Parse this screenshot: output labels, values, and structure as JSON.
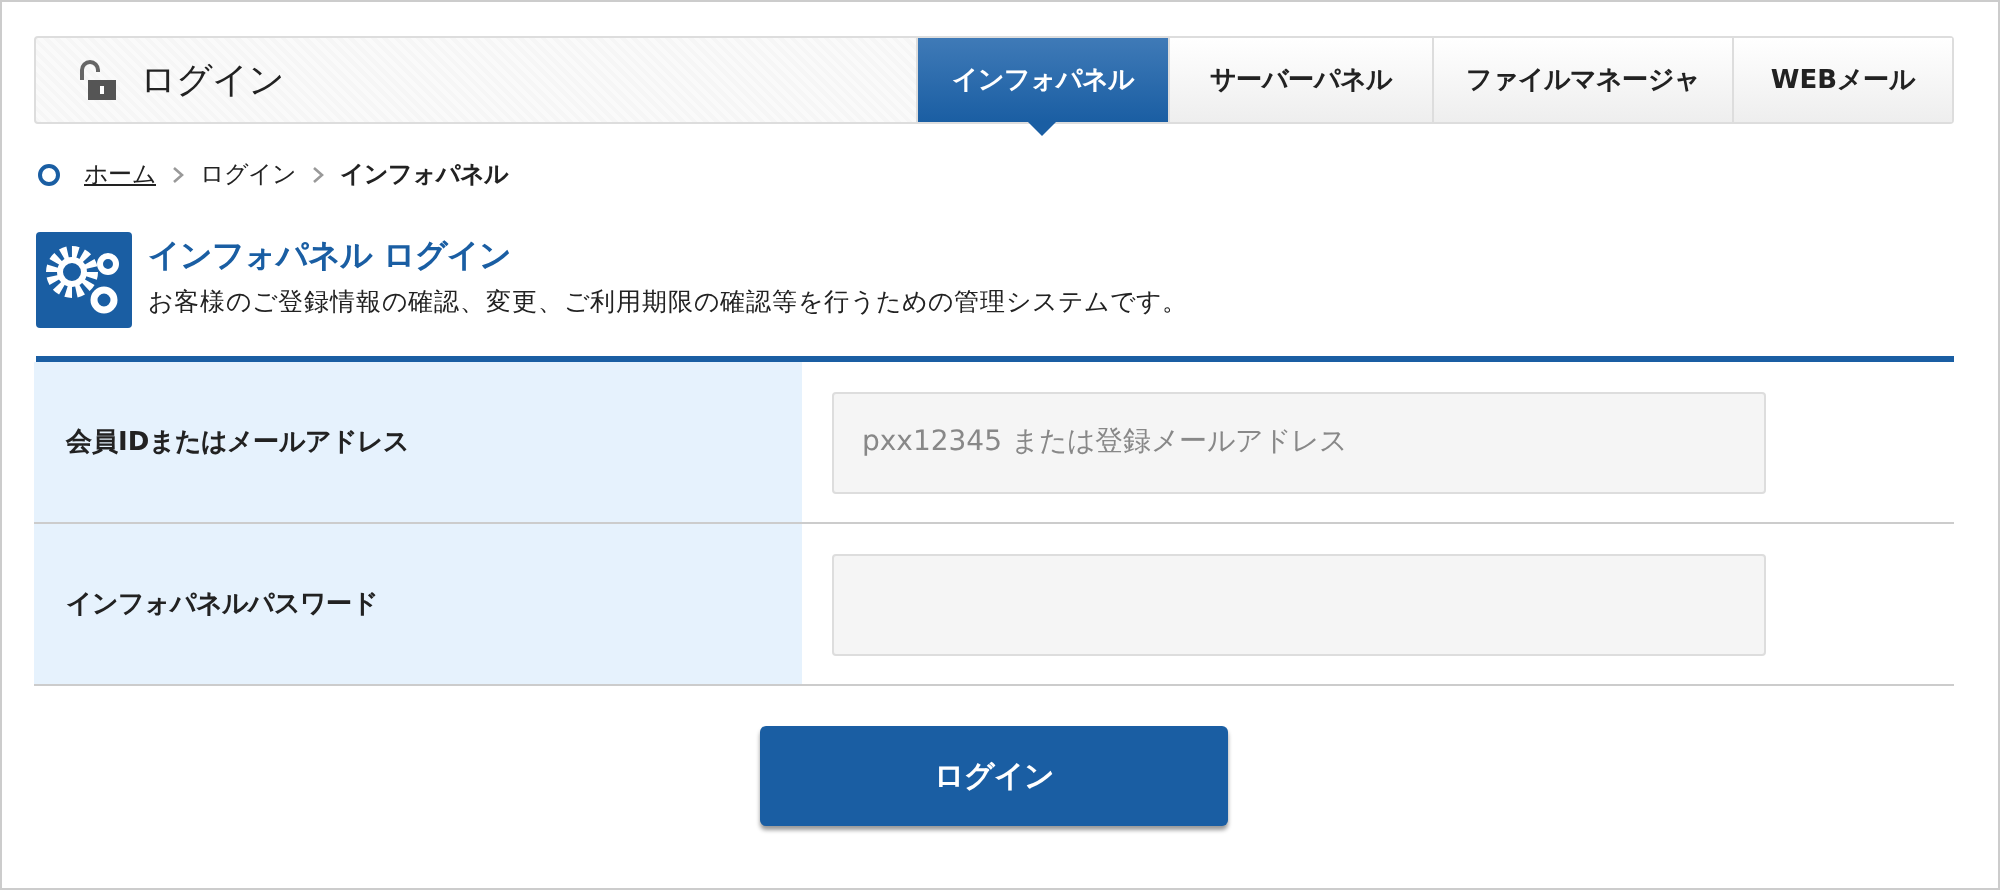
{
  "header": {
    "title": "ログイン"
  },
  "tabs": [
    {
      "label": "インフォパネル",
      "selected": true
    },
    {
      "label": "サーバーパネル",
      "selected": false
    },
    {
      "label": "ファイルマネージャ",
      "selected": false
    },
    {
      "label": "WEBメール",
      "selected": false
    }
  ],
  "breadcrumb": [
    {
      "label": "ホーム",
      "link": true
    },
    {
      "label": "ログイン",
      "link": false
    },
    {
      "label": "インフォパネル",
      "link": false
    }
  ],
  "section": {
    "title": "インフォパネル ログイン",
    "description": "お客様のご登録情報の確認、変更、ご利用期限の確認等を行うための管理システムです。"
  },
  "form": [
    {
      "label": "会員IDまたはメールアドレス",
      "placeholder": "pxx12345 または登録メールアドレス"
    },
    {
      "label": "インフォパネルパスワード"
    }
  ],
  "submit": "ログイン"
}
